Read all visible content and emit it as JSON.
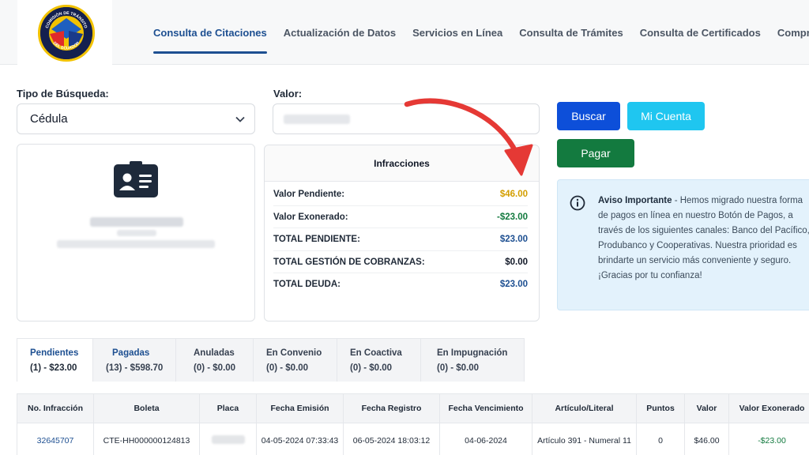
{
  "header": {
    "logo_text_top": "COMISIÓN DE TRÁNSITO",
    "logo_text_bottom": "DEL ECUADOR",
    "nav": [
      {
        "label": "Consulta de Citaciones",
        "active": true
      },
      {
        "label": "Actualización de Datos",
        "active": false
      },
      {
        "label": "Servicios en Línea",
        "active": false
      },
      {
        "label": "Consulta de Trámites",
        "active": false
      },
      {
        "label": "Consulta de Certificados",
        "active": false
      },
      {
        "label": "Comproba",
        "active": false
      }
    ]
  },
  "search": {
    "type_label": "Tipo de Búsqueda:",
    "type_value": "Cédula",
    "value_label": "Valor:"
  },
  "buttons": {
    "buscar": "Buscar",
    "mi_cuenta": "Mi Cuenta",
    "pagar": "Pagar"
  },
  "infracciones": {
    "title": "Infracciones",
    "rows": [
      {
        "label": "Valor Pendiente:",
        "value": "$46.00",
        "color": "#d39e00"
      },
      {
        "label": "Valor Exonerado:",
        "value": "-$23.00",
        "color": "#137a3f"
      },
      {
        "label": "TOTAL PENDIENTE:",
        "value": "$23.00",
        "color": "#1d4f91"
      },
      {
        "label": "TOTAL GESTIÓN DE COBRANZAS:",
        "value": "$0.00",
        "color": "#111827"
      },
      {
        "label": "TOTAL DEUDA:",
        "value": "$23.00",
        "color": "#1d4f91"
      }
    ]
  },
  "aviso": {
    "title": "Aviso Importante",
    "text": " - Hemos migrado nuestra forma de pagos en línea en nuestro Botón de Pagos, a través de los siguientes canales: Banco del Pacífico, Produbanco y Cooperativas. Nuestra prioridad es brindarte un servicio más conveniente y seguro. ¡Gracias por tu confianza!"
  },
  "tabs": [
    {
      "label": "Pendientes",
      "count": "(1) - $23.00"
    },
    {
      "label": "Pagadas",
      "count": "(13) - $598.70"
    },
    {
      "label": "Anuladas",
      "count": "(0) - $0.00"
    },
    {
      "label": "En Convenio",
      "count": "(0) - $0.00"
    },
    {
      "label": "En Coactiva",
      "count": "(0) - $0.00"
    },
    {
      "label": "En Impugnación",
      "count": "(0) - $0.00"
    }
  ],
  "table": {
    "headers": [
      "No. Infracción",
      "Boleta",
      "Placa",
      "Fecha Emisión",
      "Fecha Registro",
      "Fecha Vencimiento",
      "Artículo/Literal",
      "Puntos",
      "Valor",
      "Valor Exonerado"
    ],
    "rows": [
      [
        "32645707",
        "CTE-HH000000124813",
        "",
        "04-05-2024 07:33:43",
        "06-05-2024 18:03:12",
        "04-06-2024",
        "Artículo 391 - Numeral 11",
        "0",
        "$46.00",
        "-$23.00"
      ]
    ]
  },
  "colors": {
    "primary": "#0d4fd9",
    "info": "#1fc6f0",
    "success": "#137a3f",
    "warning": "#d39e00",
    "annotation_arrow": "#e53935"
  }
}
